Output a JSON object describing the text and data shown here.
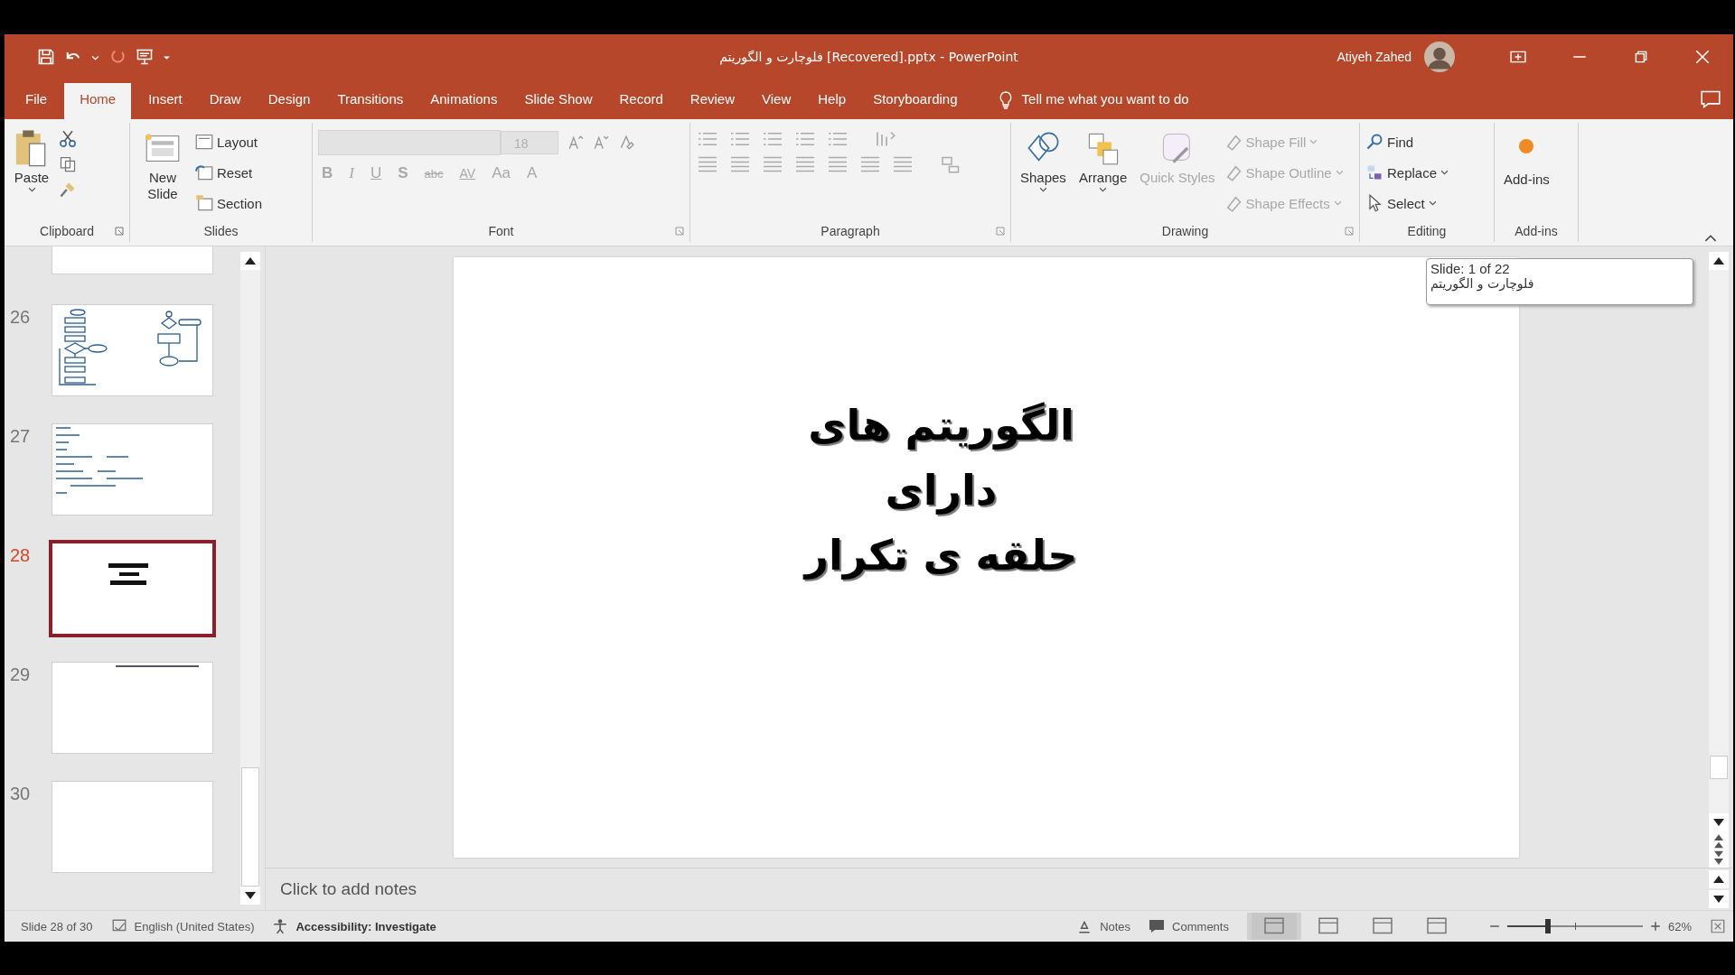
{
  "title_bar": {
    "title": "فلوچارت و الگوریتم [Recovered].pptx - PowerPoint",
    "user": "Atiyeh Zahed"
  },
  "tabs": [
    {
      "label": "File",
      "selected": false
    },
    {
      "label": "Home",
      "selected": true
    },
    {
      "label": "Insert",
      "selected": false
    },
    {
      "label": "Draw",
      "selected": false
    },
    {
      "label": "Design",
      "selected": false
    },
    {
      "label": "Transitions",
      "selected": false
    },
    {
      "label": "Animations",
      "selected": false
    },
    {
      "label": "Slide Show",
      "selected": false
    },
    {
      "label": "Record",
      "selected": false
    },
    {
      "label": "Review",
      "selected": false
    },
    {
      "label": "View",
      "selected": false
    },
    {
      "label": "Help",
      "selected": false
    },
    {
      "label": "Storyboarding",
      "selected": false
    }
  ],
  "tell_me": "Tell me what you want to do",
  "ribbon": {
    "clipboard": {
      "label": "Clipboard",
      "paste": "Paste"
    },
    "slides": {
      "label": "Slides",
      "new_slide": "New Slide",
      "layout": "Layout",
      "reset": "Reset",
      "section": "Section"
    },
    "font": {
      "label": "Font",
      "size": "18",
      "disabled": true,
      "buttons": [
        "B",
        "I",
        "U",
        "S",
        "abc",
        "AV",
        "Aa",
        "A"
      ]
    },
    "paragraph": {
      "label": "Paragraph",
      "disabled": true
    },
    "drawing": {
      "label": "Drawing",
      "shapes": "Shapes",
      "arrange": "Arrange",
      "quick_styles": {
        "label": "Quick Styles",
        "disabled": true
      },
      "items": [
        {
          "label": "Shape Fill",
          "disabled": true
        },
        {
          "label": "Shape Outline",
          "disabled": true
        },
        {
          "label": "Shape Effects",
          "disabled": true
        }
      ]
    },
    "editing": {
      "label": "Editing",
      "find": "Find",
      "replace": "Replace",
      "select": "Select"
    },
    "add_ins": {
      "label": "Add-ins",
      "button": "Add-ins"
    }
  },
  "thumbnails": [
    {
      "number": "26",
      "kind": "flowchart",
      "selected": false
    },
    {
      "number": "27",
      "kind": "text-list",
      "selected": false
    },
    {
      "number": "28",
      "kind": "title",
      "selected": true
    },
    {
      "number": "29",
      "kind": "header-line",
      "selected": false
    },
    {
      "number": "30",
      "kind": "blank",
      "selected": false
    }
  ],
  "slide": {
    "title_lines": [
      "الگوریتم های",
      "دارای",
      "حلقه ی تکرار"
    ]
  },
  "tooltip": {
    "line_1": "Slide: 1 of 22",
    "line_2": "فلوچارت و الگوریتم"
  },
  "notes": {
    "placeholder": "Click to add notes"
  },
  "status_bar": {
    "slide": "Slide 28 of 30",
    "language": "English (United States)",
    "accessibility": "Accessibility: Investigate",
    "notes": "Notes",
    "comments": "Comments",
    "views": [
      {
        "selected": true
      },
      {
        "selected": false
      },
      {
        "selected": false
      },
      {
        "selected": false
      }
    ],
    "zoom": {
      "level": 0.3,
      "reading": "62%"
    }
  }
}
